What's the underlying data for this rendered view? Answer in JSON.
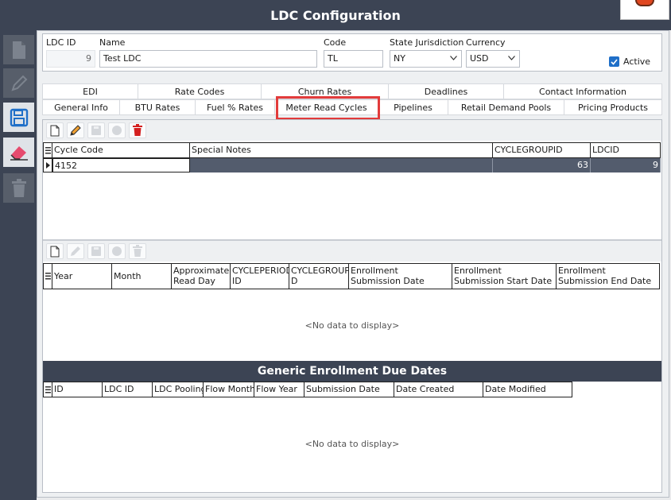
{
  "window": {
    "title": "LDC Configuration"
  },
  "header": {
    "ldc_id_label": "LDC ID",
    "ldc_id_value": "9",
    "name_label": "Name",
    "name_value": "Test LDC",
    "code_label": "Code",
    "code_value": "TL",
    "state_label": "State Jurisdiction",
    "state_value": "NY",
    "currency_label": "Currency",
    "currency_value": "USD",
    "active_label": "Active",
    "active_checked": true
  },
  "tabs": {
    "row1": [
      "EDI",
      "Rate Codes",
      "Churn Rates",
      "Deadlines",
      "Contact Information"
    ],
    "row2": [
      "General Info",
      "BTU Rates",
      "Fuel % Rates",
      "Meter Read Cycles",
      "Pipelines",
      "Retail Demand Pools",
      "Pricing Products"
    ],
    "selected": "Meter Read Cycles"
  },
  "cycles_grid": {
    "columns": [
      "Cycle Code",
      "Special Notes",
      "CYCLEGROUPID",
      "LDCID"
    ],
    "rows": [
      {
        "cycle_code": "4152",
        "special_notes": "",
        "cyclegroupid": "63",
        "ldcid": "9"
      }
    ]
  },
  "periods_grid": {
    "columns": [
      [
        "Year",
        ""
      ],
      [
        "Month",
        ""
      ],
      [
        "Approximate",
        "Read Day"
      ],
      [
        "CYCLEPERIOD",
        "ID"
      ],
      [
        "CYCLEGROUPI",
        "D"
      ],
      [
        "Enrollment",
        "Submission Date"
      ],
      [
        "Enrollment",
        "Submission Start Date"
      ],
      [
        "Enrollment",
        "Submission End Date"
      ]
    ],
    "empty_text": "<No data to display>"
  },
  "due_dates": {
    "title": "Generic Enrollment Due Dates",
    "columns": [
      "ID",
      "LDC ID",
      "LDC Pooling",
      "Flow Month",
      "Flow Year",
      "Submission Date",
      "Date Created",
      "Date Modified"
    ],
    "empty_text": "<No data to display>"
  },
  "icons": {
    "sidebar": [
      "new-document-icon",
      "edit-pencil-icon",
      "save-floppy-icon",
      "eraser-icon",
      "trash-icon"
    ],
    "toolbar": [
      "new-document-icon",
      "edit-pencil-icon",
      "save-floppy-icon",
      "cancel-circle-icon",
      "delete-trash-icon"
    ]
  },
  "colors": {
    "chrome": "#3c4454",
    "selection": "#535c6d",
    "accent_blue": "#1f6fc8",
    "highlight_red": "#e23b3b",
    "delete_red": "#d42020"
  }
}
